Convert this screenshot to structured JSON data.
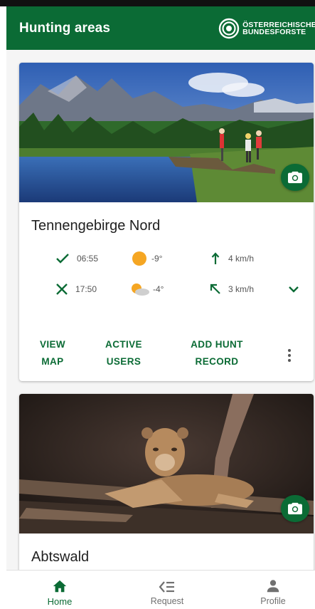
{
  "appbar": {
    "title": "Hunting areas",
    "brand_line1": "ÖSTERREICHISCHE",
    "brand_line2": "BUNDESFORSTE",
    "color": "#0b6b35"
  },
  "areas": [
    {
      "name": "Tennengebirge Nord",
      "photo_icon": "camera-icon",
      "weather": {
        "sunrise": "06:55",
        "sunset": "17:50",
        "temp_morning": "-9°",
        "temp_evening": "-4°",
        "wind_morning": "4 km/h",
        "wind_evening": "3 km/h"
      },
      "actions": {
        "view_map_l1": "VIEW",
        "view_map_l2": "MAP",
        "active_users_l1": "ACTIVE",
        "active_users_l2": "USERS",
        "add_hunt_l1": "ADD HUNT",
        "add_hunt_l2": "RECORD"
      }
    },
    {
      "name": "Abtswald",
      "photo_icon": "camera-icon"
    }
  ],
  "bottom_nav": [
    {
      "label": "Home",
      "icon": "home-icon",
      "active": true
    },
    {
      "label": "Request",
      "icon": "request-icon",
      "active": false
    },
    {
      "label": "Profile",
      "icon": "person-icon",
      "active": false
    }
  ]
}
